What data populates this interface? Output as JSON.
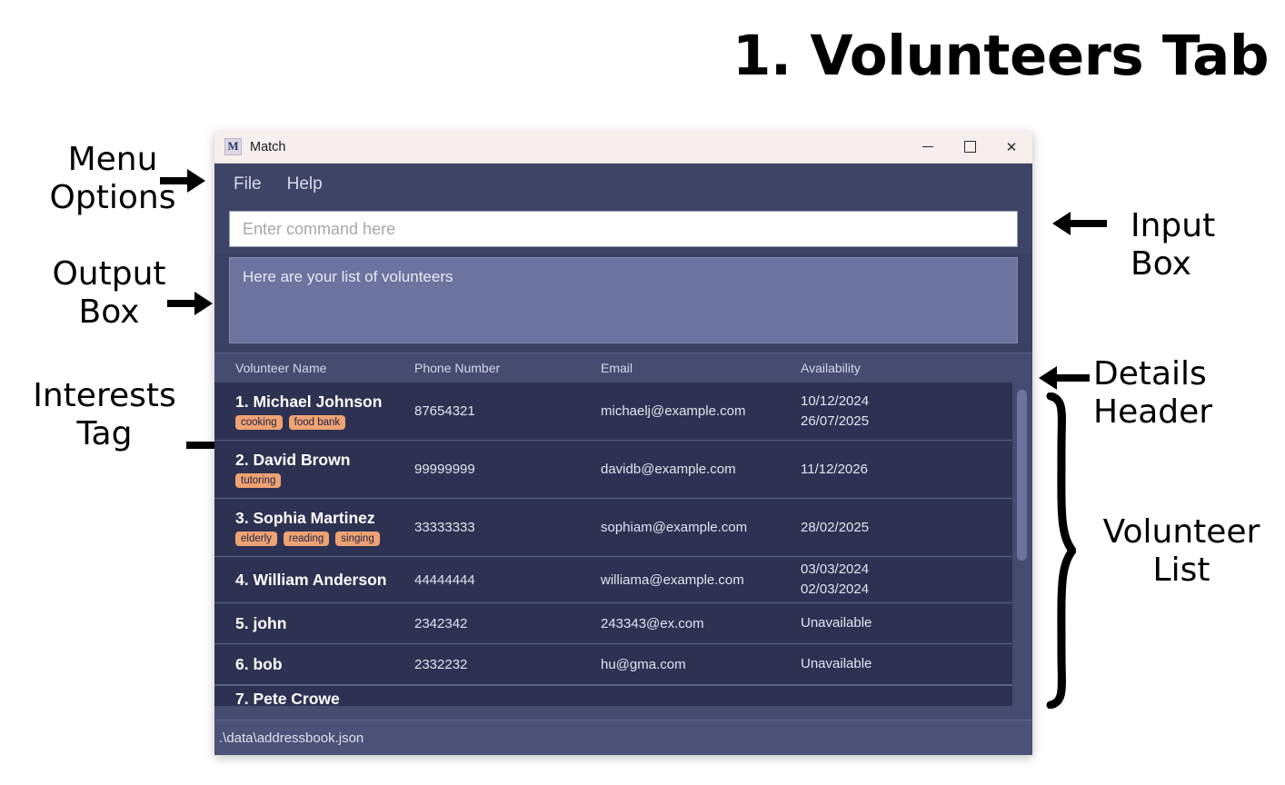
{
  "annotations": {
    "title": "1. Volunteers Tab",
    "menu_options": "Menu\nOptions",
    "output_box": "Output\nBox",
    "interests_tag": "Interests\nTag",
    "input_box": "Input Box",
    "details_header": "Details\nHeader",
    "volunteer_list": "Volunteer\nList"
  },
  "window": {
    "title": "Match",
    "icon_letter": "M",
    "controls": {
      "minimize": "–",
      "maximize": "□",
      "close": "✕"
    }
  },
  "menu": {
    "items": [
      {
        "label": "File"
      },
      {
        "label": "Help"
      }
    ]
  },
  "command": {
    "value": "",
    "placeholder": "Enter command here"
  },
  "output": {
    "text": "Here are your list of volunteers"
  },
  "list_header": {
    "columns": [
      "Volunteer Name",
      "Phone Number",
      "Email",
      "Availability"
    ]
  },
  "volunteers": [
    {
      "name": "1. Michael Johnson",
      "tags": [
        "cooking",
        "food bank"
      ],
      "phone": "87654321",
      "email": "michaelj@example.com",
      "availability": "10/12/2024\n26/07/2025"
    },
    {
      "name": "2. David Brown",
      "tags": [
        "tutoring"
      ],
      "phone": "99999999",
      "email": "davidb@example.com",
      "availability": "11/12/2026"
    },
    {
      "name": "3. Sophia Martinez",
      "tags": [
        "elderly",
        "reading",
        "singing"
      ],
      "phone": "33333333",
      "email": "sophiam@example.com",
      "availability": "28/02/2025"
    },
    {
      "name": "4. William Anderson",
      "tags": [],
      "phone": "44444444",
      "email": "williama@example.com",
      "availability": "03/03/2024\n02/03/2024"
    },
    {
      "name": "5. john",
      "tags": [],
      "phone": "2342342",
      "email": "243343@ex.com",
      "availability": "Unavailable"
    },
    {
      "name": "6. bob",
      "tags": [],
      "phone": "2332232",
      "email": "hu@gma.com",
      "availability": "Unavailable"
    }
  ],
  "volunteer_cutoff": {
    "name": "7. Pete Crowe"
  },
  "statusbar": {
    "path": ".\\data\\addressbook.json"
  },
  "colors": {
    "window_bg": "#3b4163",
    "titlebar_bg": "#f7eeee",
    "menubar_bg": "#3e4466",
    "output_bg": "#6d739f",
    "list_header_bg": "#464c70",
    "row_bg": "#2d3252",
    "row_border": "#5c638b",
    "tag_bg": "#efa272",
    "tag_text": "#23264a",
    "statusbar_bg": "#4b5177",
    "scroll_thumb": "#6c739e",
    "input_bg": "#ffffff",
    "placeholder": "#a8a8a8"
  }
}
